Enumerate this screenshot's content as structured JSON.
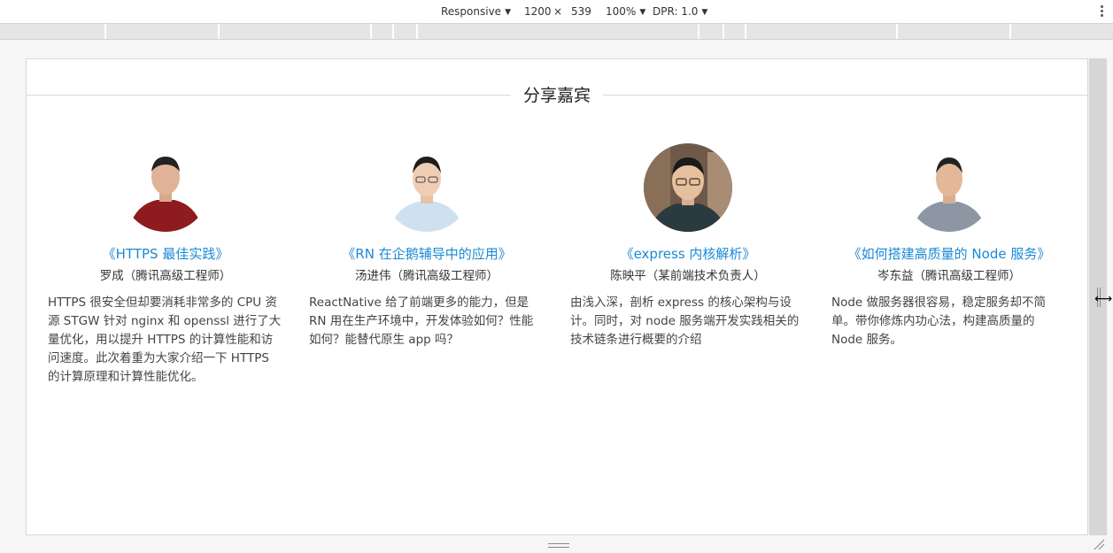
{
  "toolbar": {
    "device": "Responsive",
    "width": "1200",
    "times": "×",
    "height": "539",
    "zoom": "100%",
    "dpr": "DPR: 1.0"
  },
  "page": {
    "section_title": "分享嘉宾",
    "speakers": [
      {
        "talk": "《HTTPS 最佳实践》",
        "name": "罗成（腾讯高级工程师）",
        "desc": "HTTPS 很安全但却要消耗非常多的 CPU 资源 STGW 针对 nginx 和 openssl 进行了大量优化，用以提升 HTTPS 的计算性能和访问速度。此次着重为大家介绍一下 HTTPS 的计算原理和计算性能优化。",
        "shirt": "#8e1b1e"
      },
      {
        "talk": "《RN 在企鹅辅导中的应用》",
        "name": "汤进伟（腾讯高级工程师）",
        "desc": "ReactNative 给了前端更多的能力，但是 RN 用在生产环境中，开发体验如何？性能如何？能替代原生 app 吗？",
        "shirt": "#cfe0ef"
      },
      {
        "talk": "《express 内核解析》",
        "name": "陈映平（某前端技术负责人）",
        "desc": "由浅入深，剖析 express 的核心架构与设计。同时，对 node 服务端开发实践相关的技术链条进行概要的介绍",
        "shirt": "#2b3a3f"
      },
      {
        "talk": "《如何搭建高质量的 Node 服务》",
        "name": "岑东益（腾讯高级工程师）",
        "desc": "Node 做服务器很容易，稳定服务却不简单。带你修炼内功心法，构建高质量的 Node 服务。",
        "shirt": "#8d97a3"
      }
    ]
  },
  "colors": {
    "link": "#1a8ad4",
    "ruler": "#e5e5e5"
  }
}
